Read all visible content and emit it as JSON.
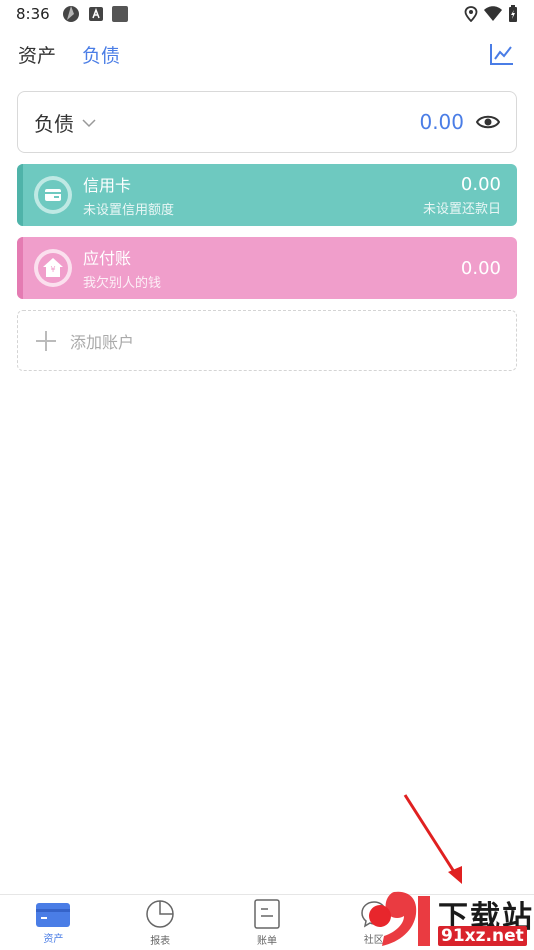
{
  "status": {
    "time": "8:36"
  },
  "tabs": {
    "assets": "资产",
    "liabilities": "负债"
  },
  "summary": {
    "label": "负债",
    "amount": "0.00"
  },
  "accounts": [
    {
      "name": "信用卡",
      "sub": "未设置信用额度",
      "amount": "0.00",
      "note": "未设置还款日"
    },
    {
      "name": "应付账",
      "sub": "我欠别人的钱",
      "amount": "0.00",
      "note": ""
    }
  ],
  "add_account": {
    "label": "添加账户"
  },
  "nav": [
    {
      "label": "资产"
    },
    {
      "label": "报表"
    },
    {
      "label": "账单"
    },
    {
      "label": "社区"
    }
  ],
  "watermark": {
    "text": "下载站",
    "url": "91xz.net"
  },
  "colors": {
    "accent": "#4a7de6",
    "credit": "#6ec9c0",
    "payable": "#f09ecb"
  }
}
